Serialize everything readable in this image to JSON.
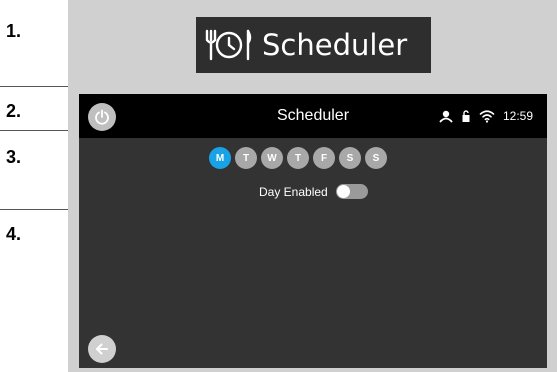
{
  "steps": [
    "1.",
    "2.",
    "3.",
    "4."
  ],
  "banner": {
    "title": "Scheduler",
    "icon": "clock-cutlery-icon"
  },
  "screen": {
    "title": "Scheduler",
    "status": {
      "icons": [
        "person-icon",
        "lock-icon",
        "wifi-icon"
      ],
      "time": "12:59"
    },
    "days": [
      {
        "label": "M",
        "active": true
      },
      {
        "label": "T",
        "active": false
      },
      {
        "label": "W",
        "active": false
      },
      {
        "label": "T",
        "active": false
      },
      {
        "label": "F",
        "active": false
      },
      {
        "label": "S",
        "active": false
      },
      {
        "label": "S",
        "active": false
      }
    ],
    "day_enabled": {
      "label": "Day Enabled",
      "on": false
    }
  },
  "colors": {
    "accent": "#19a3e6",
    "screen_bg": "#333333",
    "topbar_bg": "#000000",
    "frame": "#d0d0d0"
  }
}
